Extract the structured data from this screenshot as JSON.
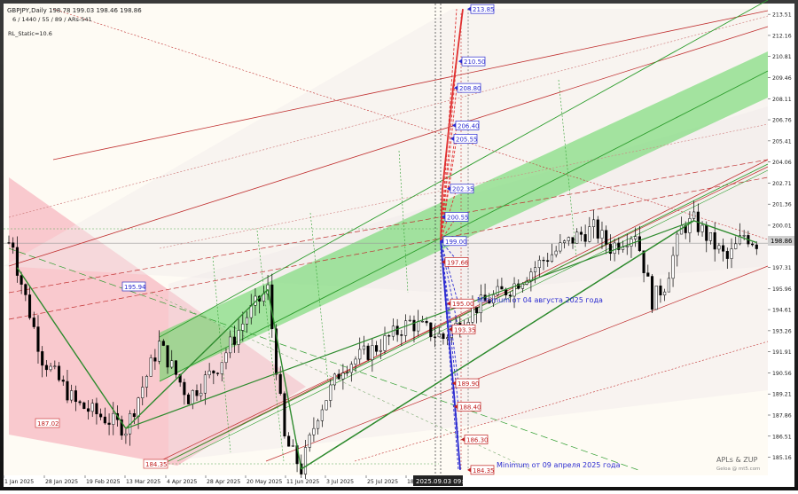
{
  "header": {
    "symbol_line": "GBPJPY,Daily  198.78 199.03 198.46 198.86",
    "settings_line": "6 / 1440 / 55 / 89 / ARs-541",
    "static_label": "RL_Static=10.6"
  },
  "watermark": {
    "line1": "APLs & ZUP",
    "line2": "Geloa @ mt5.com"
  },
  "cursor_time": "2025.09.03 09:50",
  "current_price": "198.86",
  "annotations": {
    "min_aug": "Minimum от 04 августа 2025 года",
    "min_apr": "Minimum от 09 апреля 2025 года"
  },
  "level_labels": [
    {
      "price": 213.85,
      "text": "213.85",
      "color": "blue"
    },
    {
      "price": 210.5,
      "text": "210.50",
      "color": "blue"
    },
    {
      "price": 208.8,
      "text": "208.80",
      "color": "blue"
    },
    {
      "price": 206.4,
      "text": "206.40",
      "color": "blue"
    },
    {
      "price": 205.55,
      "text": "205.55",
      "color": "blue"
    },
    {
      "price": 202.35,
      "text": "202.35",
      "color": "blue"
    },
    {
      "price": 200.55,
      "text": "200.55",
      "color": "blue"
    },
    {
      "price": 199.0,
      "text": "199.00",
      "color": "blue"
    },
    {
      "price": 197.66,
      "text": "197.66",
      "color": "red"
    },
    {
      "price": 195.0,
      "text": "195.00",
      "color": "red"
    },
    {
      "price": 193.35,
      "text": "193.35",
      "color": "red"
    },
    {
      "price": 189.9,
      "text": "189.90",
      "color": "red"
    },
    {
      "price": 188.4,
      "text": "188.40",
      "color": "red"
    },
    {
      "price": 186.3,
      "text": "186.30",
      "color": "red"
    },
    {
      "price": 184.35,
      "text": "184.35",
      "color": "red"
    }
  ],
  "swing_labels": [
    {
      "text": "195.94",
      "color": "blue"
    },
    {
      "text": "187.02",
      "color": "red"
    },
    {
      "text": "184.35",
      "color": "red"
    }
  ],
  "chart_data": {
    "type": "candlestick",
    "x_ticks": [
      "1 Jan 2025",
      "28 Jan 2025",
      "19 Feb 2025",
      "13 Mar 2025",
      "4 Apr 2025",
      "28 Apr 2025",
      "20 May 2025",
      "11 Jun 2025",
      "3 Jul 2025",
      "25 Jul 2025",
      "18 Aug 2025"
    ],
    "y_ticks": [
      213.51,
      212.16,
      210.81,
      209.46,
      208.11,
      206.76,
      205.41,
      204.06,
      202.71,
      201.36,
      200.01,
      197.31,
      195.96,
      194.61,
      193.26,
      191.91,
      190.56,
      189.21,
      187.86,
      186.51,
      185.16
    ],
    "ylim": [
      184.0,
      214.2
    ],
    "close_path": [
      {
        "x": 2,
        "y": 197.3
      },
      {
        "x": 8,
        "y": 191.5
      },
      {
        "x": 16,
        "y": 188.6
      },
      {
        "x": 28,
        "y": 187.0
      },
      {
        "x": 36,
        "y": 192.4
      },
      {
        "x": 43,
        "y": 189.0
      },
      {
        "x": 50,
        "y": 191.0
      },
      {
        "x": 57,
        "y": 194.2
      },
      {
        "x": 62,
        "y": 195.9
      },
      {
        "x": 64,
        "y": 191.0
      },
      {
        "x": 66,
        "y": 186.3
      },
      {
        "x": 70,
        "y": 184.4
      },
      {
        "x": 74,
        "y": 188.0
      },
      {
        "x": 80,
        "y": 191.0
      },
      {
        "x": 88,
        "y": 192.2
      },
      {
        "x": 96,
        "y": 193.8
      },
      {
        "x": 104,
        "y": 192.8
      },
      {
        "x": 112,
        "y": 194.8
      },
      {
        "x": 120,
        "y": 196.0
      },
      {
        "x": 128,
        "y": 197.8
      },
      {
        "x": 136,
        "y": 199.3
      },
      {
        "x": 140,
        "y": 199.8
      },
      {
        "x": 144,
        "y": 198.6
      },
      {
        "x": 150,
        "y": 199.6
      },
      {
        "x": 154,
        "y": 195.2
      },
      {
        "x": 157,
        "y": 196.2
      },
      {
        "x": 161,
        "y": 199.8
      },
      {
        "x": 164,
        "y": 200.3
      },
      {
        "x": 168,
        "y": 199.0
      },
      {
        "x": 172,
        "y": 197.8
      },
      {
        "x": 176,
        "y": 199.4
      },
      {
        "x": 179,
        "y": 198.9
      }
    ]
  }
}
